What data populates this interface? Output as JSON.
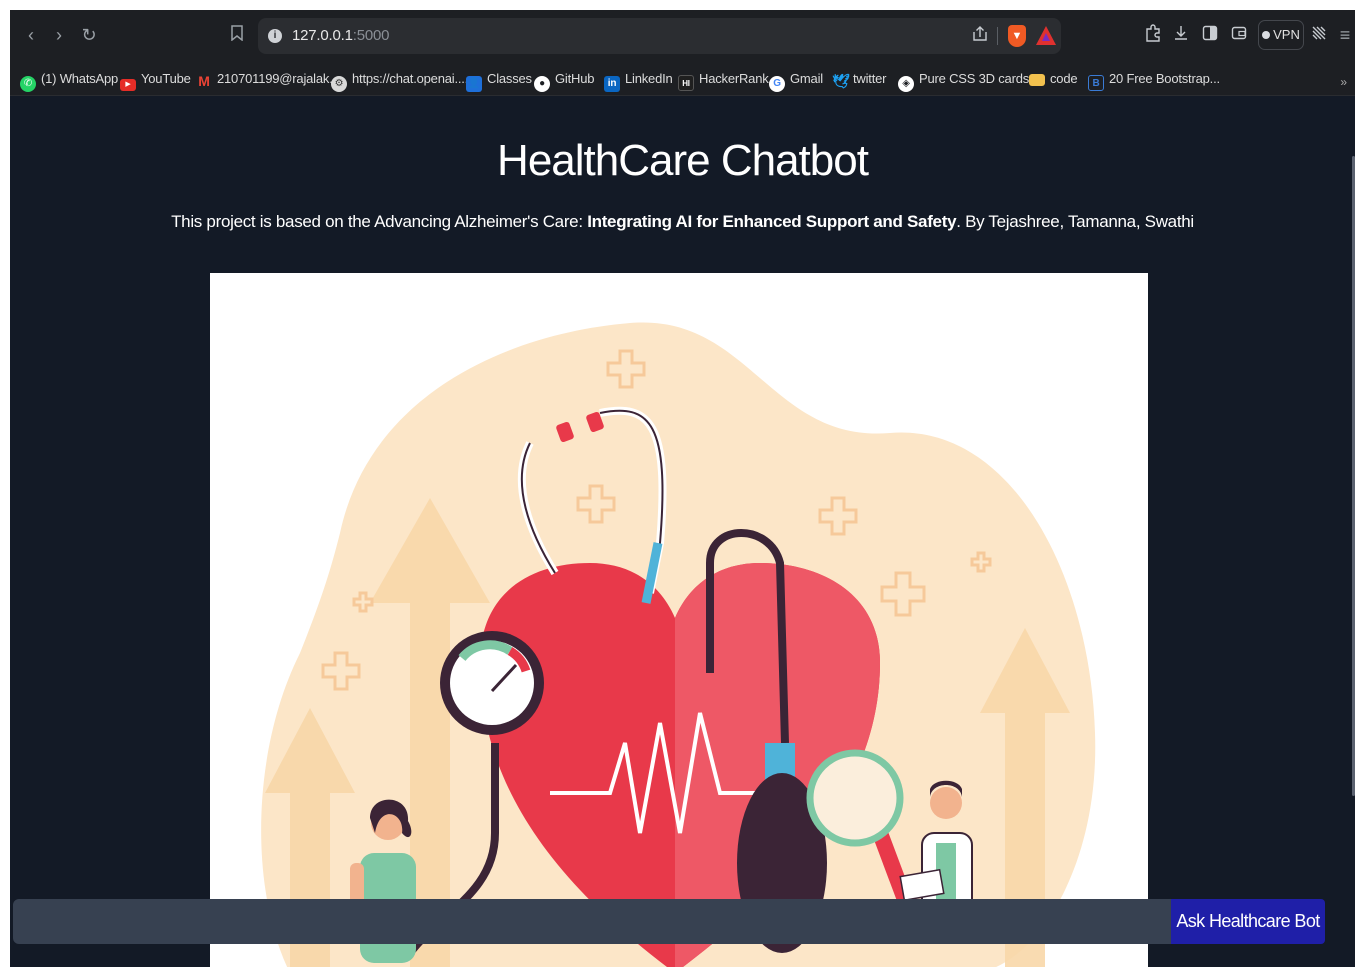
{
  "browser": {
    "url_host": "127.0.0.1",
    "url_port": ":5000",
    "vpn_label": "VPN",
    "bookmarks": [
      {
        "label": "(1) WhatsApp",
        "icon": "whatsapp-icon",
        "color": "#25d366"
      },
      {
        "label": "YouTube",
        "icon": "youtube-icon",
        "color": "#e52d27"
      },
      {
        "label": "210701199@rajalak...",
        "icon": "gmail-icon",
        "color": "#ea4335"
      },
      {
        "label": "https://chat.openai....",
        "icon": "openai-icon",
        "color": "#d9d9d9"
      },
      {
        "label": "Classes",
        "icon": "classroom-icon",
        "color": "#1e6fd9"
      },
      {
        "label": "GitHub",
        "icon": "github-icon",
        "color": "#ffffff"
      },
      {
        "label": "LinkedIn",
        "icon": "linkedin-icon",
        "color": "#0a66c2"
      },
      {
        "label": "HackerRank",
        "icon": "hackerrank-icon",
        "color": "#1f1f1f"
      },
      {
        "label": "Gmail",
        "icon": "google-icon",
        "color": "#ffffff"
      },
      {
        "label": "twitter",
        "icon": "twitter-icon",
        "color": "#1da1f2"
      },
      {
        "label": "Pure CSS 3D cards,...",
        "icon": "codepen-icon",
        "color": "#ffffff"
      },
      {
        "label": "code",
        "icon": "folder-icon",
        "color": "#f2c14e"
      },
      {
        "label": "20 Free Bootstrap...",
        "icon": "bootstrap-icon",
        "color": "#3a7bd5"
      }
    ],
    "more_label": "»"
  },
  "page": {
    "title": "HealthCare Chatbot",
    "subtitle_prefix": "This project is based on the Advancing Alzheimer's Care: ",
    "subtitle_bold": "Integrating AI for Enhanced Support and Safety",
    "subtitle_suffix": ". By Tejashree, Tamanna, Swathi",
    "chat_placeholder": "",
    "chat_button": "Ask Healthcare Bot"
  },
  "colors": {
    "page_bg": "#131a26",
    "button_bg": "#1f1fa8",
    "input_bg": "#374151",
    "heart_red": "#e8394a",
    "blob_peach": "#fce6c8"
  }
}
